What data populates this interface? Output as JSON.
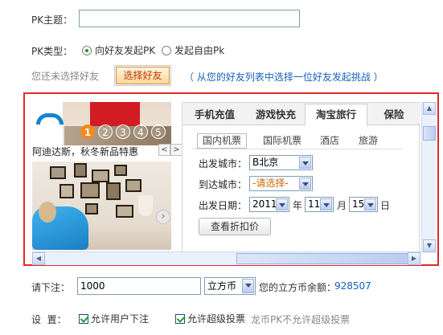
{
  "form": {
    "pk_topic_label": "PK主题：",
    "pk_topic_value": "",
    "pk_type_label": "PK类型：",
    "pk_type_options": [
      {
        "label": "向好友发起PK",
        "selected": true
      },
      {
        "label": "发起自由Pk",
        "selected": false
      }
    ],
    "friend_status": "您还未选择好友",
    "choose_friend_button": "选择好友",
    "friend_tip": "（ 从您的好友列表中选择一位好友发起挑战 ）",
    "bet_label": "请下注：",
    "bet_value": "1000",
    "bet_unit": "立方币",
    "balance_label": "您的立方币余额：",
    "balance_value": "928507",
    "settings_label": "设  置：",
    "allow_bet_label": "允许用户下注",
    "allow_super_label": "允许超级投票",
    "super_note": "龙币PK不允许超级投票"
  },
  "ad": {
    "carousel_numbers": [
      "1",
      "2",
      "3",
      "4",
      "5"
    ],
    "carousel_active": "1",
    "promo_text": "阿迪达斯，秋冬新品特惠",
    "prev": "<",
    "next": ">",
    "side_next": "›"
  },
  "travel": {
    "tabs": [
      "手机充值",
      "游戏快充",
      "淘宝旅行",
      "保险"
    ],
    "active_tab": "淘宝旅行",
    "subtabs": [
      "国内机票",
      "国际机票",
      "酒店",
      "旅游"
    ],
    "active_subtab": "国内机票",
    "from_label": "出发城市：",
    "from_value": "B北京",
    "to_label": "到达城市：",
    "to_value": "-请选择-",
    "date_label": "出发日期：",
    "year": "2011",
    "year_unit": "年",
    "month": "11",
    "month_unit": "月",
    "day": "15",
    "day_unit": "日",
    "search_button": "查看折扣价"
  },
  "colors": {
    "frame_border": "#e0282e",
    "tip_blue": "#1762b8",
    "carousel_active": "#f28a1e"
  }
}
